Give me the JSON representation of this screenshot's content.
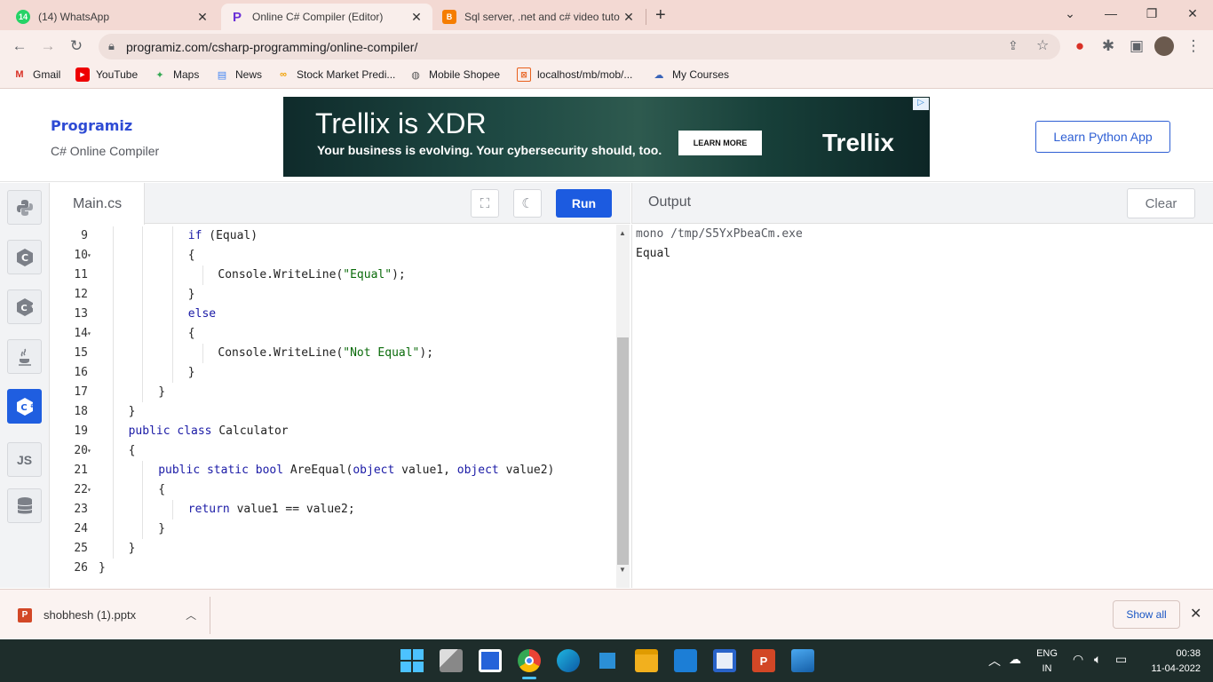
{
  "browser": {
    "tabs": [
      {
        "title": "(14) WhatsApp",
        "badge": "14",
        "active": false
      },
      {
        "title": "Online C# Compiler (Editor)",
        "active": true
      },
      {
        "title": "Sql server, .net and c# video tuto",
        "active": false
      }
    ],
    "new_tab": "+",
    "url": "programiz.com/csharp-programming/online-compiler/",
    "bookmarks": [
      {
        "label": "Gmail",
        "icon": "gmail-icon"
      },
      {
        "label": "YouTube",
        "icon": "youtube-icon"
      },
      {
        "label": "Maps",
        "icon": "maps-icon"
      },
      {
        "label": "News",
        "icon": "news-icon"
      },
      {
        "label": "Stock Market Predi...",
        "icon": "coursera-icon"
      },
      {
        "label": "Mobile Shopee",
        "icon": "globe-icon"
      },
      {
        "label": "localhost/mb/mob/...",
        "icon": "xampp-icon"
      },
      {
        "label": "My Courses",
        "icon": "courses-icon"
      }
    ]
  },
  "site": {
    "logo": "Programiz",
    "subtitle": "C# Online Compiler",
    "learn_button": "Learn Python App",
    "ad": {
      "title": "Trellix is XDR",
      "subtitle": "Your business is evolving. Your cybersecurity should, too.",
      "button": "LEARN MORE",
      "brand": "Trellix"
    }
  },
  "sidebar": {
    "languages": [
      "python-icon",
      "c-icon",
      "cpp-icon",
      "java-icon",
      "csharp-icon",
      "js-icon",
      "sql-icon"
    ],
    "js_label": "JS"
  },
  "editor": {
    "file_tab": "Main.cs",
    "run_label": "Run",
    "lines": [
      {
        "n": "9",
        "fold": false,
        "indent": 3,
        "tokens": [
          [
            "kw",
            "if"
          ],
          [
            "t",
            " (Equal)"
          ]
        ]
      },
      {
        "n": "10",
        "fold": true,
        "indent": 3,
        "tokens": [
          [
            "t",
            "{"
          ]
        ]
      },
      {
        "n": "11",
        "fold": false,
        "indent": 4,
        "tokens": [
          [
            "t",
            "Console.WriteLine("
          ],
          [
            "str",
            "\"Equal\""
          ],
          [
            "t",
            ");"
          ]
        ]
      },
      {
        "n": "12",
        "fold": false,
        "indent": 3,
        "tokens": [
          [
            "t",
            "}"
          ]
        ]
      },
      {
        "n": "13",
        "fold": false,
        "indent": 3,
        "tokens": [
          [
            "kw",
            "else"
          ]
        ]
      },
      {
        "n": "14",
        "fold": true,
        "indent": 3,
        "tokens": [
          [
            "t",
            "{"
          ]
        ]
      },
      {
        "n": "15",
        "fold": false,
        "indent": 4,
        "tokens": [
          [
            "t",
            "Console.WriteLine("
          ],
          [
            "str",
            "\"Not Equal\""
          ],
          [
            "t",
            ");"
          ]
        ]
      },
      {
        "n": "16",
        "fold": false,
        "indent": 3,
        "tokens": [
          [
            "t",
            "}"
          ]
        ]
      },
      {
        "n": "17",
        "fold": false,
        "indent": 2,
        "tokens": [
          [
            "t",
            "}"
          ]
        ]
      },
      {
        "n": "18",
        "fold": false,
        "indent": 1,
        "tokens": [
          [
            "t",
            "}"
          ]
        ]
      },
      {
        "n": "19",
        "fold": false,
        "indent": 1,
        "tokens": [
          [
            "kw",
            "public class"
          ],
          [
            "t",
            " Calculator"
          ]
        ]
      },
      {
        "n": "20",
        "fold": true,
        "indent": 1,
        "tokens": [
          [
            "t",
            "{"
          ]
        ]
      },
      {
        "n": "21",
        "fold": false,
        "indent": 2,
        "tokens": [
          [
            "kw",
            "public static bool"
          ],
          [
            "t",
            " AreEqual("
          ],
          [
            "kw",
            "object"
          ],
          [
            "t",
            " value1, "
          ],
          [
            "kw",
            "object"
          ],
          [
            "t",
            " value2)"
          ]
        ]
      },
      {
        "n": "22",
        "fold": true,
        "indent": 2,
        "tokens": [
          [
            "t",
            "{"
          ]
        ]
      },
      {
        "n": "23",
        "fold": false,
        "indent": 3,
        "tokens": [
          [
            "kw",
            "return"
          ],
          [
            "t",
            " value1 == value2;"
          ]
        ]
      },
      {
        "n": "24",
        "fold": false,
        "indent": 2,
        "tokens": [
          [
            "t",
            "}"
          ]
        ]
      },
      {
        "n": "25",
        "fold": false,
        "indent": 1,
        "tokens": [
          [
            "t",
            "}"
          ]
        ]
      },
      {
        "n": "26",
        "fold": false,
        "indent": 0,
        "tokens": [
          [
            "t",
            "}"
          ]
        ]
      }
    ]
  },
  "output": {
    "label": "Output",
    "clear_label": "Clear",
    "command": "mono /tmp/S5YxPbeaCm.exe",
    "result": "Equal"
  },
  "downloads": {
    "file": "shobhesh (1).pptx",
    "show_all": "Show all"
  },
  "taskbar": {
    "lang_line1": "ENG",
    "lang_line2": "IN",
    "time": "00:38",
    "date": "11-04-2022"
  }
}
